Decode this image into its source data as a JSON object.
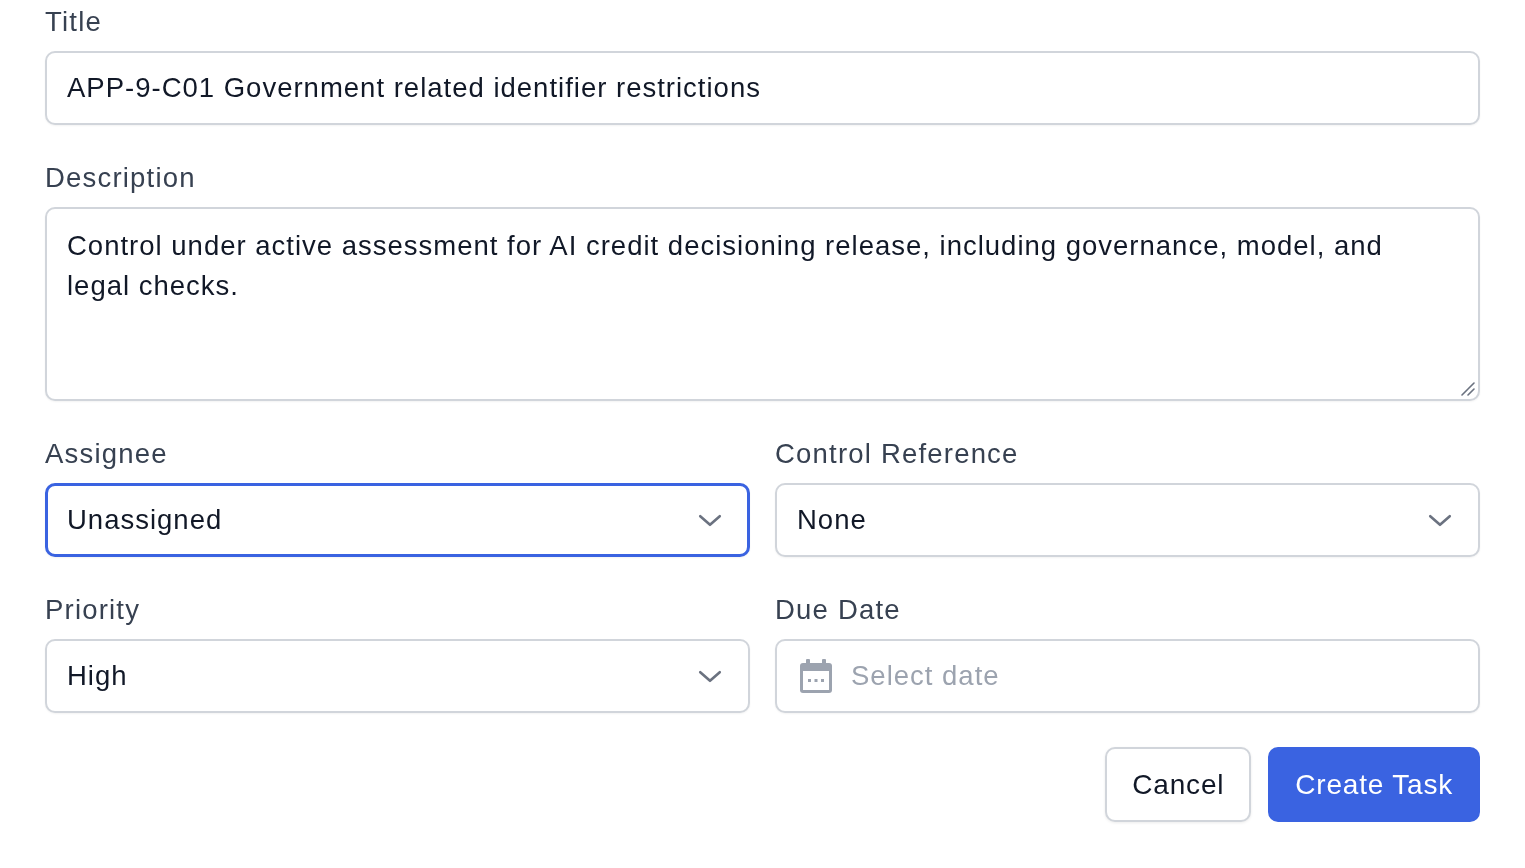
{
  "fields": [
    {
      "kind": "text",
      "label": "Title",
      "value": "APP-9-C01 Government related identifier restrictions",
      "focused": false
    },
    {
      "kind": "textarea",
      "label": "Description",
      "value": "Control under active assessment for AI credit decisioning release, including governance, model, and legal checks.",
      "focused": false
    }
  ],
  "field_grid": [
    {
      "kind": "select",
      "label": "Assignee",
      "value": "Unassigned",
      "focused": true
    },
    {
      "kind": "select",
      "label": "Control Reference",
      "value": "None",
      "focused": false
    },
    {
      "kind": "select",
      "label": "Priority",
      "value": "High",
      "focused": false
    },
    {
      "kind": "date",
      "label": "Due Date",
      "placeholder": "Select date",
      "focused": false
    }
  ],
  "buttons": [
    {
      "kind": "secondary",
      "label": "Cancel"
    },
    {
      "kind": "primary",
      "label": "Create Task"
    }
  ]
}
